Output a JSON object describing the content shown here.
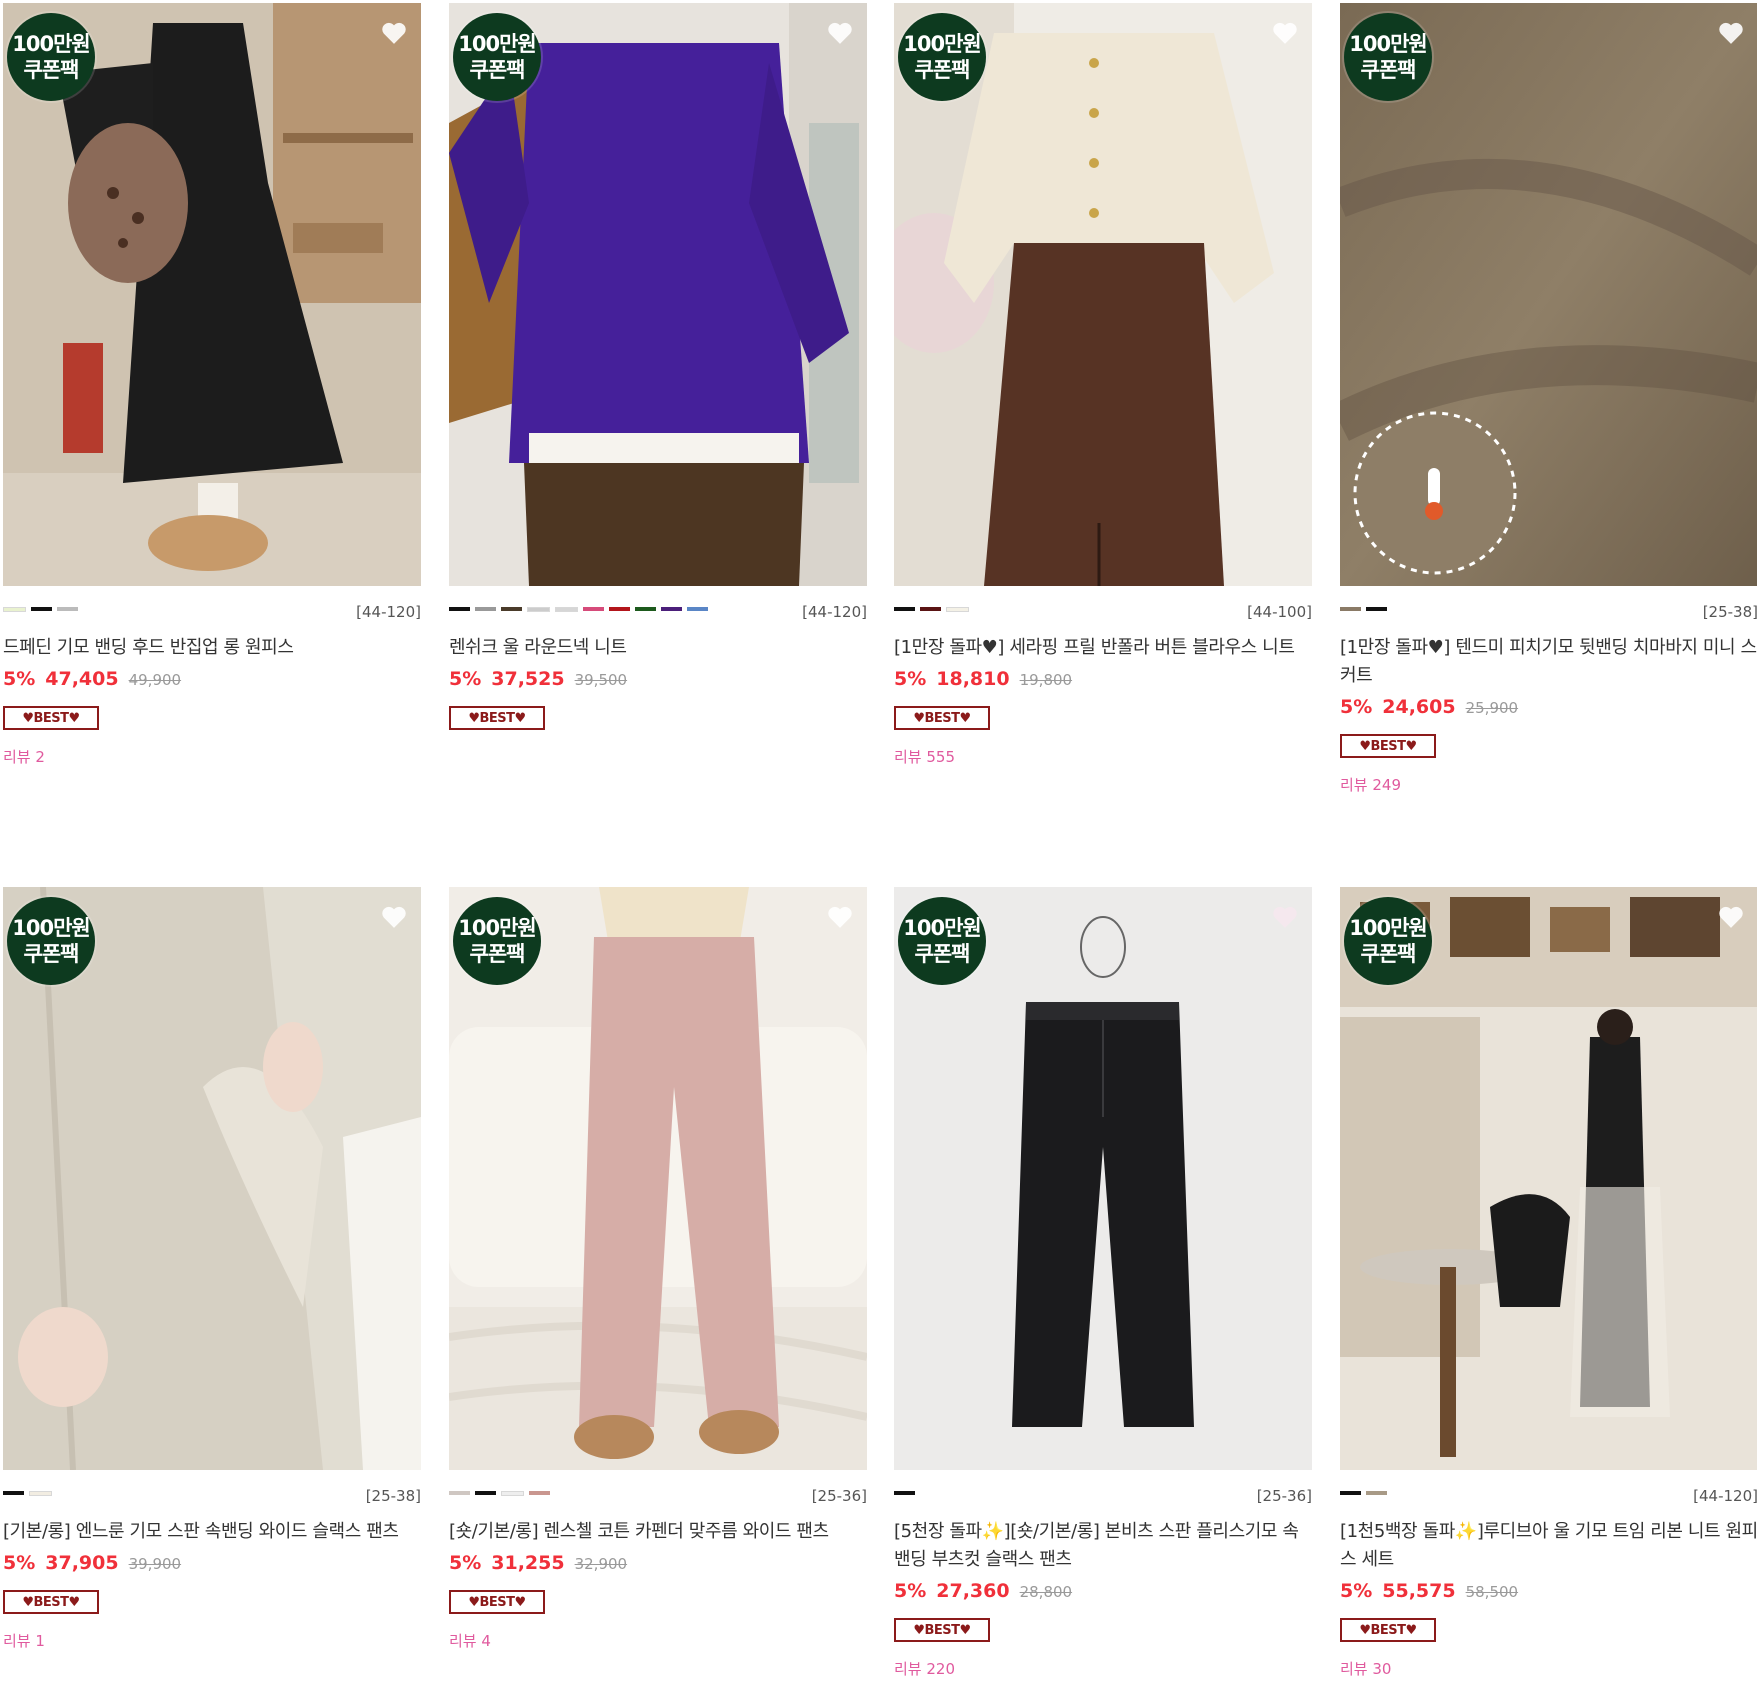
{
  "coupon": {
    "line1": "100만원",
    "line2": "쿠폰팩"
  },
  "products": [
    {
      "size": "[44-120]",
      "title": "드페딘 기모 밴딩 후드 반집업 롱 원피스",
      "discount": "5%",
      "price": "47,405",
      "original": "49,900",
      "badge": "♥BEST♥",
      "review": "리뷰 2",
      "swatches": [
        "#e9f2cf",
        "#111111",
        "#bbbbbb"
      ]
    },
    {
      "size": "[44-120]",
      "title": "렌쉬크 울 라운드넥 니트",
      "discount": "5%",
      "price": "37,525",
      "original": "39,500",
      "badge": "♥BEST♥",
      "review": "",
      "swatches": [
        "#111111",
        "#999999",
        "#4a3b2a",
        "#cccccc",
        "#d6d6d6",
        "#d64b7a",
        "#b3151b",
        "#1d5a1d",
        "#4b1f7a",
        "#5a86c6"
      ]
    },
    {
      "size": "[44-100]",
      "title": "[1만장 돌파♥] 세라핑 프릴 반폴라 버튼 블라우스 니트",
      "discount": "5%",
      "price": "18,810",
      "original": "19,800",
      "badge": "♥BEST♥",
      "review": "리뷰 555",
      "swatches": [
        "#111111",
        "#5a1414",
        "#f4f1e6"
      ]
    },
    {
      "size": "[25-38]",
      "title": "[1만장 돌파♥] 텐드미 피치기모 뒷밴딩 치마바지 미니 스커트",
      "discount": "5%",
      "price": "24,605",
      "original": "25,900",
      "badge": "♥BEST♥",
      "review": "리뷰 249",
      "swatches": [
        "#8a7a66",
        "#111111"
      ]
    },
    {
      "size": "[25-38]",
      "title": "[기본/롱] 엔느룬 기모 스판 속밴딩 와이드 슬랙스 팬츠",
      "discount": "5%",
      "price": "37,905",
      "original": "39,900",
      "badge": "♥BEST♥",
      "review": "리뷰 1",
      "swatches": [
        "#111111",
        "#f2ede2"
      ]
    },
    {
      "size": "[25-36]",
      "title": "[숏/기본/롱] 렌스첼 코튼 카펜더 맞주름 와이드 팬츠",
      "discount": "5%",
      "price": "31,255",
      "original": "32,900",
      "badge": "♥BEST♥",
      "review": "리뷰 4",
      "swatches": [
        "#cfc7c2",
        "#111111",
        "#eeeeee",
        "#c9968f"
      ]
    },
    {
      "size": "[25-36]",
      "title": "[5천장 돌파✨][숏/기본/롱] 본비츠 스판 플리스기모 속밴딩 부츠컷 슬랙스 팬츠",
      "discount": "5%",
      "price": "27,360",
      "original": "28,800",
      "badge": "♥BEST♥",
      "review": "리뷰 220",
      "swatches": [
        "#111111"
      ]
    },
    {
      "size": "[44-120]",
      "title": "[1천5백장 돌파✨]루디브아 울 기모 트임 리본 니트 원피스 세트",
      "discount": "5%",
      "price": "55,575",
      "original": "58,500",
      "badge": "♥BEST♥",
      "review": "리뷰 30",
      "swatches": [
        "#111111",
        "#a89a86"
      ]
    }
  ]
}
